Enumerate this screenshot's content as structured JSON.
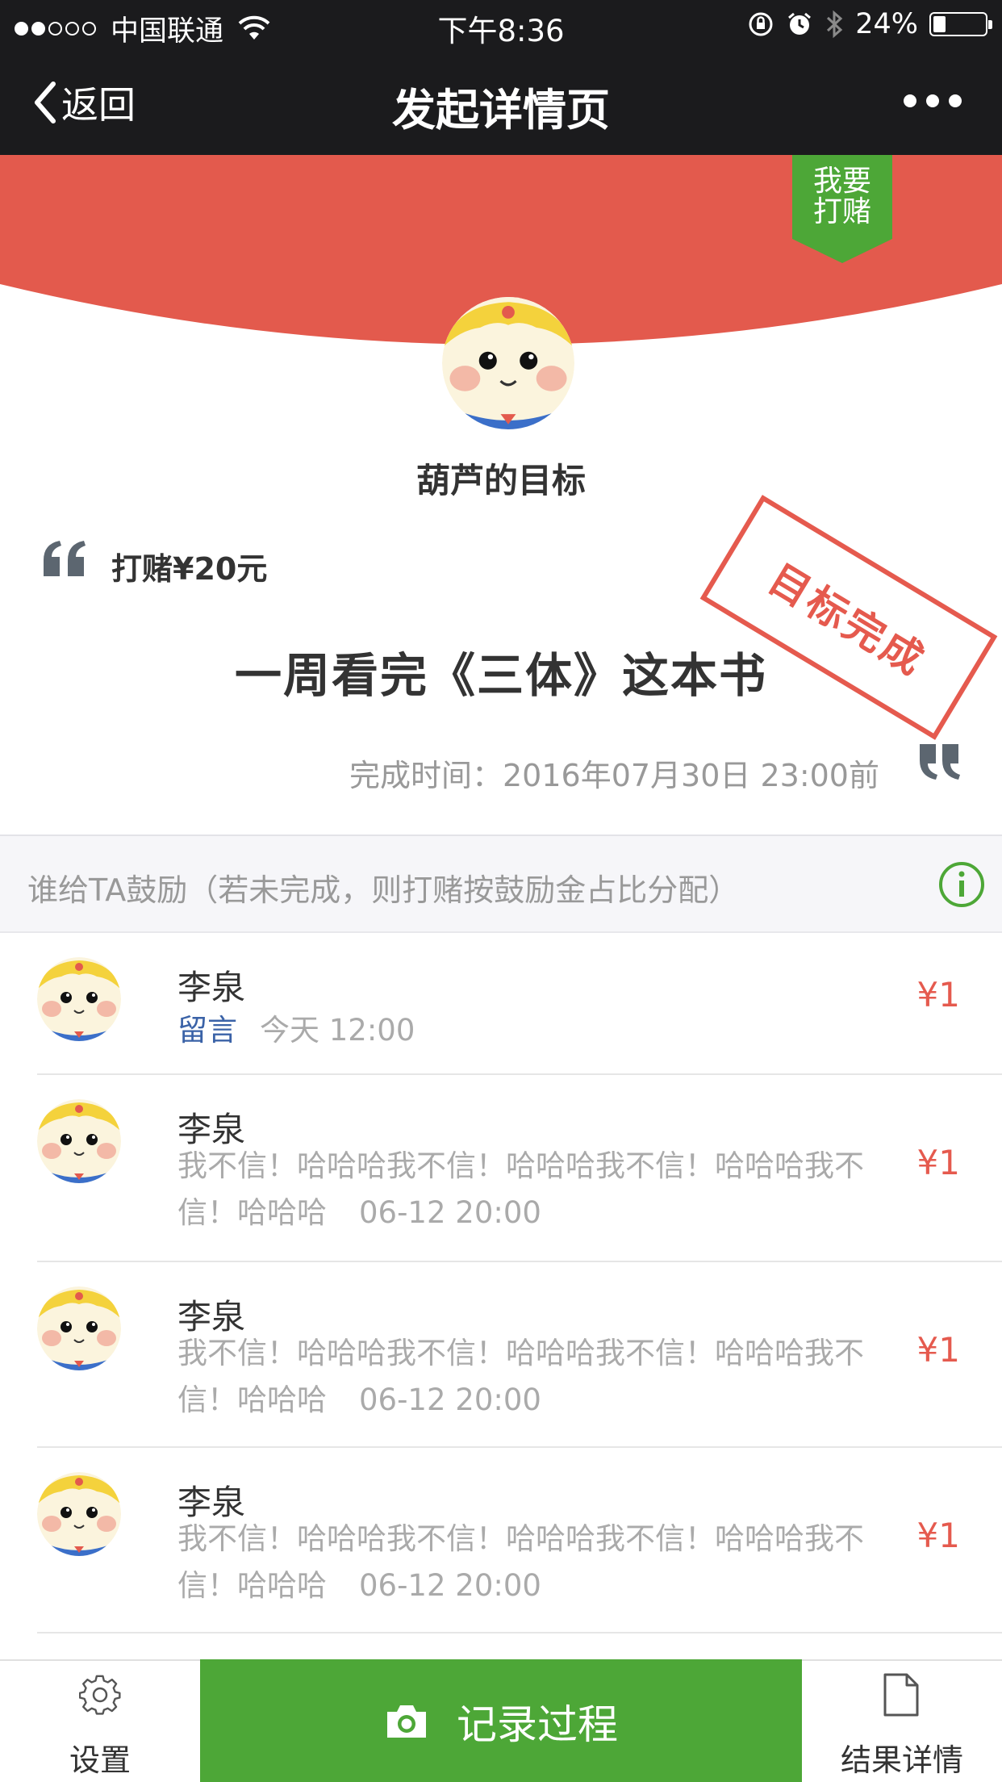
{
  "status_bar": {
    "carrier": "中国联通",
    "time": "下午8:36",
    "battery": "24%",
    "battery_level": 0.24
  },
  "nav": {
    "back_label": "返回",
    "title": "发起详情页"
  },
  "header": {
    "bet_ribbon": "我要\n打赌",
    "owner_goal_label": "葫芦的目标",
    "bet_amount": "打赌¥20元",
    "goal_text": "一周看完《三体》这本书",
    "deadline": "完成时间：2016年07月30日 23:00前",
    "stamp": "目标完成"
  },
  "encourage_section": {
    "title": "谁给TA鼓励（若未完成，则打赌按鼓励金占比分配）"
  },
  "encouragements": [
    {
      "name": "李泉",
      "link": "留言",
      "time": "今天 12:00",
      "amount": "¥1"
    },
    {
      "name": "李泉",
      "message": "我不信！哈哈哈我不信！哈哈哈我不信！哈哈哈我不信！哈哈哈",
      "time": "06-12 20:00",
      "amount": "¥1"
    },
    {
      "name": "李泉",
      "message": "我不信！哈哈哈我不信！哈哈哈我不信！哈哈哈我不信！哈哈哈",
      "time": "06-12 20:00",
      "amount": "¥1"
    },
    {
      "name": "李泉",
      "message": "我不信！哈哈哈我不信！哈哈哈我不信！哈哈哈我不信！哈哈哈",
      "time": "06-12 20:00",
      "amount": "¥1"
    }
  ],
  "bottom_bar": {
    "settings_label": "设置",
    "record_label": "记录过程",
    "result_label": "结果详情"
  },
  "colors": {
    "banner_red": "#e35a4d",
    "ribbon_green": "#4da737",
    "amount_red": "#e55a4e",
    "link_blue": "#3a62a7",
    "dark_bar": "#1b1b1d"
  }
}
